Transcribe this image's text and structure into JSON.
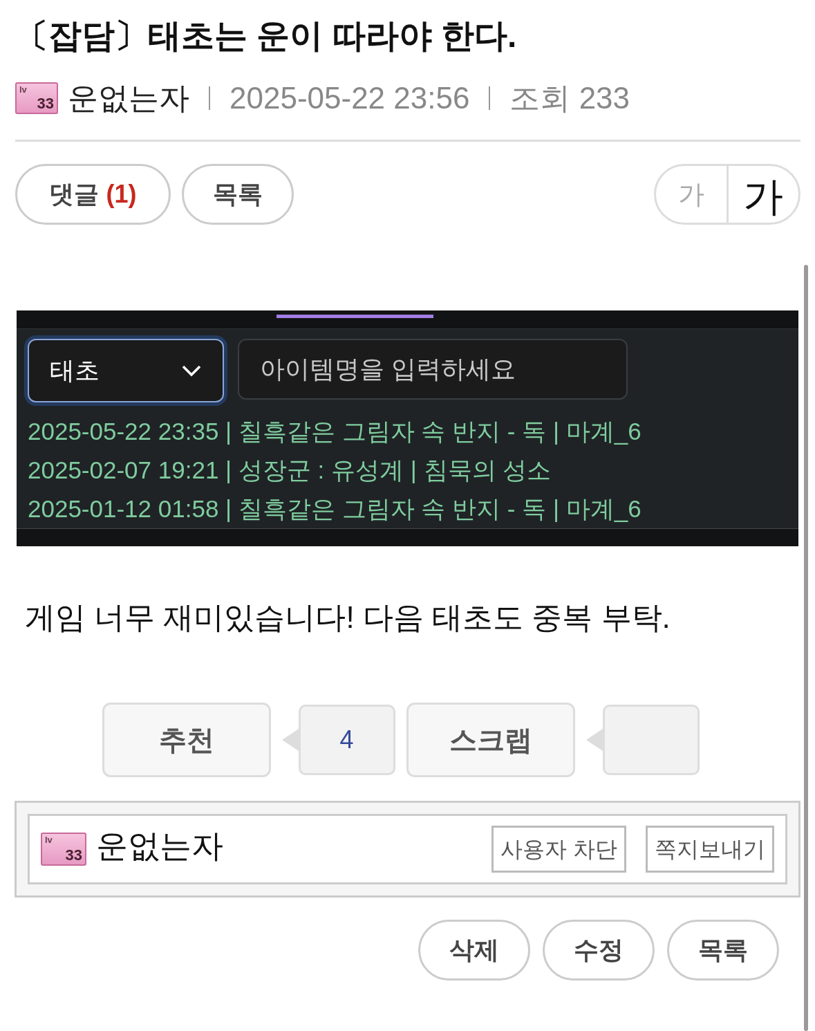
{
  "title": "〔잡담〕태초는 운이 따라야 한다.",
  "meta": {
    "badge_prefix": "lv",
    "badge": "33",
    "author": "운없는자",
    "date": "2025-05-22 23:56",
    "views_label": "조회",
    "views": "233"
  },
  "top_buttons": [
    {
      "label": "댓글",
      "count": "(1)"
    },
    {
      "label": "목록"
    }
  ],
  "font_size_buttons": [
    {
      "label": "가",
      "kind": "small"
    },
    {
      "label": "가",
      "kind": "large"
    }
  ],
  "embedded_screenshot": {
    "select": {
      "value": "태초"
    },
    "search": {
      "placeholder": "아이템명을 입력하세요"
    },
    "log_lines": [
      "2025-05-22 23:35 | 칠흑같은 그림자 속 반지 - 독 | 마계_6",
      "2025-02-07 19:21 | 성장군 : 유성계 | 침묵의 성소",
      "2025-01-12 01:58 | 칠흑같은 그림자 속 반지 - 독 | 마계_6"
    ]
  },
  "body": "게임 너무 재미있습니다! 다음 태초도 중복 부탁.",
  "votes": [
    {
      "label": "추천",
      "count": "4"
    },
    {
      "label": "스크랩"
    }
  ],
  "author_box": {
    "badge_prefix": "lv",
    "badge": "33",
    "author": "운없는자",
    "buttons": [
      "사용자 차단",
      "쪽지보내기"
    ]
  },
  "bottom_buttons": [
    "삭제",
    "수정",
    "목록"
  ]
}
